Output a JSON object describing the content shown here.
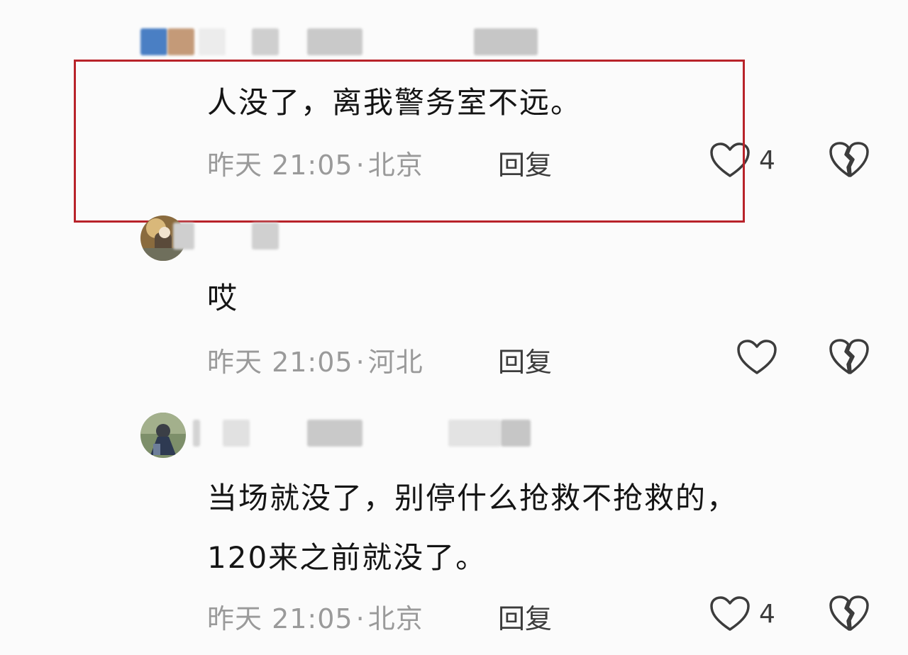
{
  "colors": {
    "highlight_border": "#b8232a",
    "meta_text": "#9a9a9a",
    "body_text": "#151515"
  },
  "comments": [
    {
      "text": "人没了，离我警务室不远。",
      "time": "昨天 21:05",
      "sep": "·",
      "location": "北京",
      "reply_label": "回复",
      "likes": "4",
      "highlighted": true
    },
    {
      "text": "哎",
      "time": "昨天 21:05",
      "sep": "·",
      "location": "河北",
      "reply_label": "回复",
      "likes": ""
    },
    {
      "text_line1": "当场就没了，别停什么抢救不抢救的，",
      "text_line2": "120来之前就没了。",
      "time": "昨天 21:05",
      "sep": "·",
      "location": "北京",
      "reply_label": "回复",
      "likes": "4"
    }
  ],
  "icons": {
    "like": "heart-outline-icon",
    "dislike": "broken-heart-icon"
  }
}
